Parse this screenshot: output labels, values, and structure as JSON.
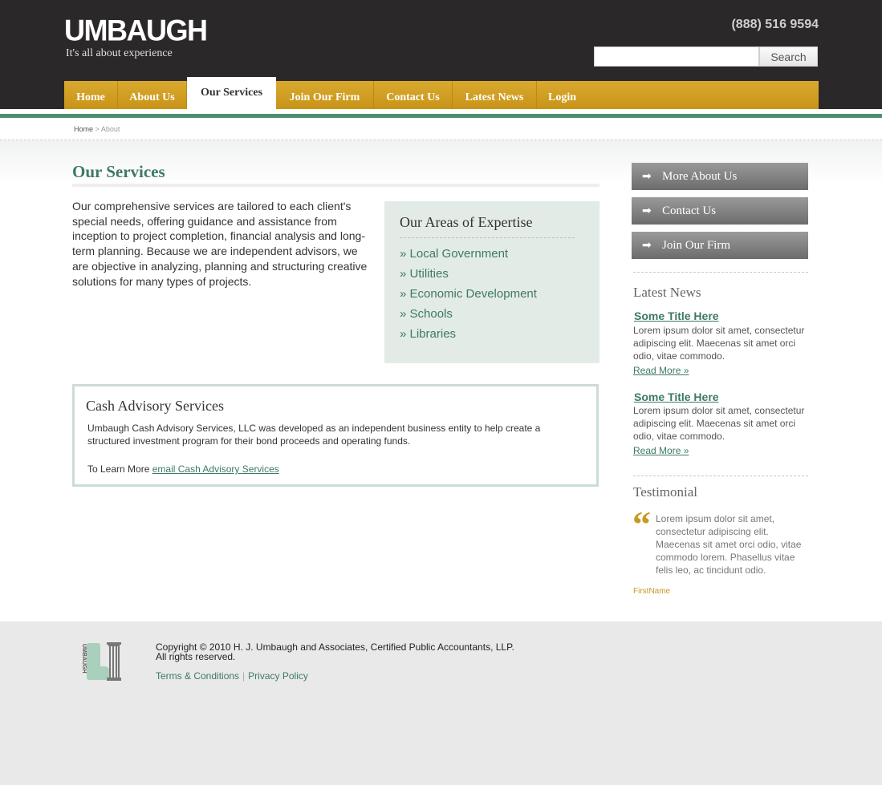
{
  "header": {
    "logo": "UMBAUGH",
    "tagline": "It's all about experience",
    "phone": "(888) 516 9594",
    "search_placeholder": "",
    "search_label": "Search"
  },
  "nav": {
    "items": [
      "Home",
      "About Us",
      "Our Services",
      "Join Our Firm",
      "Contact Us",
      "Latest News",
      "Login"
    ],
    "active": "Our Services"
  },
  "breadcrumb": {
    "home": "Home",
    "sep": ">",
    "current": "About"
  },
  "main": {
    "title": "Our Services",
    "intro": "Our comprehensive services are tailored to each client's special needs, offering guidance and assistance from inception to project completion, financial analysis and long-term planning. Because we are independent advisors, we are objective in analyzing, planning and structuring creative solutions for many types of projects.",
    "expertise": {
      "title": "Our Areas of Expertise",
      "items": [
        "» Local Government",
        "» Utilities",
        "» Economic Development",
        "» Schools",
        "» Libraries"
      ]
    },
    "cash": {
      "title": "Cash Advisory Services",
      "text": "Umbaugh Cash Advisory Services, LLC was developed as an independent business entity to help create a structured investment program for their bond proceeds and operating funds.",
      "more_prefix": "To Learn More",
      "more_link": "email Cash Advisory Services"
    }
  },
  "sidebar": {
    "buttons": [
      "More About Us",
      "Contact Us",
      "Join Our Firm"
    ],
    "news_heading": "Latest News",
    "news": [
      {
        "title": "Some Title Here",
        "body": "Lorem ipsum dolor sit amet, consectetur adipiscing elit. Maecenas sit amet orci odio, vitae commodo.",
        "more": "Read More »"
      },
      {
        "title": "Some Title Here",
        "body": "Lorem ipsum dolor sit amet, consectetur adipiscing elit. Maecenas sit amet orci odio, vitae commodo.",
        "more": "Read More »"
      }
    ],
    "testimonial_heading": "Testimonial",
    "testimonial_text": "Lorem ipsum dolor sit amet, consectetur adipiscing elit. Maecenas sit amet orci odio, vitae commodo lorem. Phasellus vitae felis leo, ac tincidunt odio.",
    "testimonial_name": "FirstName"
  },
  "footer": {
    "logo_text": "UMBAUGH",
    "copyright_line1": "Copyright © 2010 H. J. Umbaugh and Associates, Certified Public Accountants, LLP.",
    "copyright_line2": "All rights reserved.",
    "terms": "Terms & Conditions",
    "link_sep": "|",
    "privacy": "Privacy Policy"
  },
  "colors": {
    "header_bg": "#2b2829",
    "nav_gold": "#d4a22a",
    "brand_green": "#3e7a62",
    "stripe_green": "#4e8e71",
    "expertise_bg": "#e3ebe6",
    "quote_gold": "#c79a22"
  },
  "icons": {
    "sidebar_arrow": "arrow-right-icon",
    "quote": "quote-icon",
    "footer_logo": "umbaugh-column-logo-icon"
  }
}
